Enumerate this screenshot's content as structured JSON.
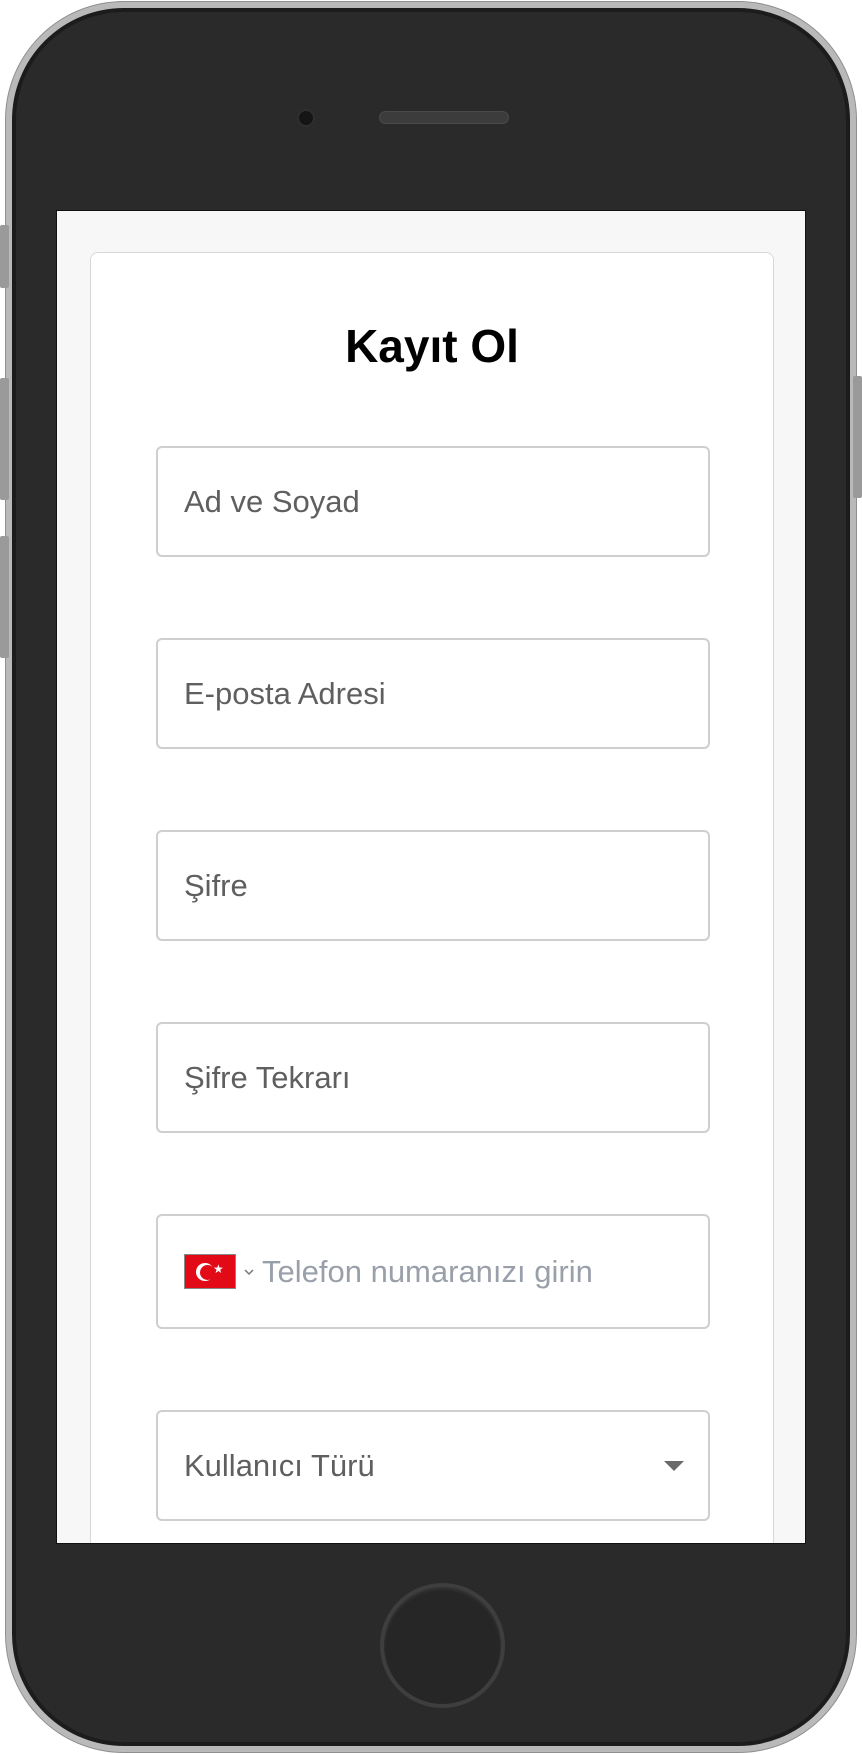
{
  "form": {
    "title": "Kayıt Ol",
    "fullname_placeholder": "Ad ve Soyad",
    "email_placeholder": "E-posta Adresi",
    "password_placeholder": "Şifre",
    "password_repeat_placeholder": "Şifre Tekrarı",
    "phone_placeholder": "Telefon numaranızı girin",
    "phone_country": "TR",
    "user_type_label": "Kullanıcı Türü"
  },
  "icons": {
    "flag": "turkey-flag-icon",
    "country_dropdown": "chevron-down-icon",
    "select_caret": "caret-down-icon"
  },
  "colors": {
    "flag_red": "#e30a17",
    "placeholder_phone": "#9aa0aa",
    "field_border": "#cfcfcf"
  }
}
